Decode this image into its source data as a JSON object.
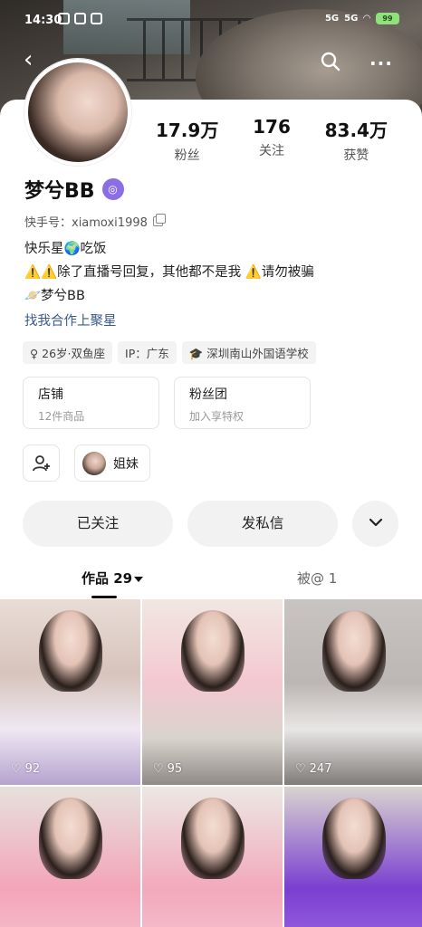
{
  "status_bar": {
    "time": "14:30",
    "signal_1": "5G",
    "signal_2": "5G",
    "battery": "99"
  },
  "profile": {
    "name": "梦兮BB",
    "kuaishou_id": "快手号：xiamoxi1998",
    "stats": [
      {
        "value": "17.9万",
        "label": "粉丝"
      },
      {
        "value": "176",
        "label": "关注"
      },
      {
        "value": "83.4万",
        "label": "获赞"
      }
    ],
    "bio_lines": [
      "快乐星🌍吃饭",
      "⚠️⚠️除了直播号回复，其他都不是我 ⚠️请勿被骗",
      "🪐梦兮BB"
    ],
    "collab_link": "找我合作上聚星",
    "tags": [
      "♀ 26岁·双鱼座",
      "IP：广东",
      "🎓 深圳南山外国语学校"
    ]
  },
  "boxes": {
    "shop": {
      "title": "店铺",
      "sub": "12件商品"
    },
    "fan_group": {
      "title": "粉丝团",
      "sub": "加入享特权"
    }
  },
  "relation_chip": {
    "label": "姐妹"
  },
  "actions": {
    "followed": "已关注",
    "message": "发私信"
  },
  "tabs": {
    "works": "作品 29",
    "mentions": "被@ 1"
  },
  "posts": [
    {
      "likes": "92"
    },
    {
      "likes": "95"
    },
    {
      "likes": "247"
    },
    {
      "likes": ""
    },
    {
      "likes": ""
    },
    {
      "likes": ""
    }
  ],
  "icons": {
    "back": "back-arrow-icon",
    "search": "search-icon",
    "more": "more-icon",
    "copy": "copy-icon",
    "add_friend": "add-friend-icon",
    "expand": "chevron-down-icon",
    "heart": "heart-icon"
  },
  "colors": {
    "link": "#3a5a8c",
    "vip_badge": "#8b6de6",
    "button_bg": "#f2f2f2"
  }
}
